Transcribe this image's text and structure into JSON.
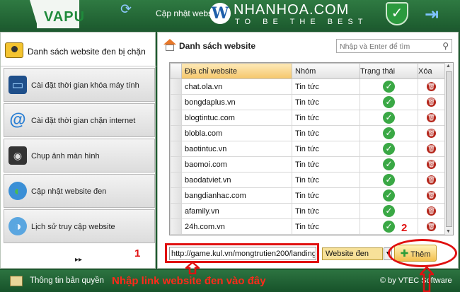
{
  "header": {
    "app_name": "VAPU",
    "title": "Cập nhật website",
    "watermark_brand": "NHANHOA.COM",
    "watermark_tagline": "TO BE THE BEST",
    "watermark_badge": "W"
  },
  "sidebar": {
    "header": "Danh sách website đen bị chặn",
    "items": [
      {
        "label": "Cài đặt thời gian khóa máy tính",
        "icon": "monitor-icon"
      },
      {
        "label": "Cài đặt thời gian chặn internet",
        "icon": "at-sign-icon"
      },
      {
        "label": "Chụp ảnh màn hình",
        "icon": "camera-icon"
      },
      {
        "label": "Cập nhật website đen",
        "icon": "globe-icon"
      },
      {
        "label": "Lịch sử truy cập website",
        "icon": "globe-search-icon"
      }
    ],
    "expand": "▸▸"
  },
  "main": {
    "title": "Danh sách website",
    "search_placeholder": "Nhập và Enter để tìm",
    "columns": [
      "Địa chỉ website",
      "Nhóm",
      "Trạng thái",
      "Xóa"
    ],
    "rows": [
      {
        "site": "chat.ola.vn",
        "group": "Tin tức"
      },
      {
        "site": "bongdaplus.vn",
        "group": "Tin tức"
      },
      {
        "site": "blogtintuc.com",
        "group": "Tin tức"
      },
      {
        "site": "blobla.com",
        "group": "Tin tức"
      },
      {
        "site": "baotintuc.vn",
        "group": "Tin tức"
      },
      {
        "site": "baomoi.com",
        "group": "Tin tức"
      },
      {
        "site": "baodatviet.vn",
        "group": "Tin tức"
      },
      {
        "site": "bangdianhac.com",
        "group": "Tin tức"
      },
      {
        "site": "afamily.vn",
        "group": "Tin tức"
      },
      {
        "site": "24h.com.vn",
        "group": "Tin tức"
      }
    ],
    "url_input_value": "http://game.kul.vn/mongtrutien200/landing",
    "group_select_value": "Website đen",
    "add_label": "Thêm"
  },
  "footer": {
    "license": "Thông tin bản quyền",
    "copyright": "© by VTEC Software"
  },
  "annotations": {
    "num1": "1",
    "num2": "2",
    "instruction": "Nhập link website đen vào đây",
    "color": "#e01010"
  },
  "colors": {
    "header_green": "#2f7a42",
    "accent_gold": "#f3c04f",
    "status_green": "#3aa845",
    "delete_red": "#b5271c"
  }
}
